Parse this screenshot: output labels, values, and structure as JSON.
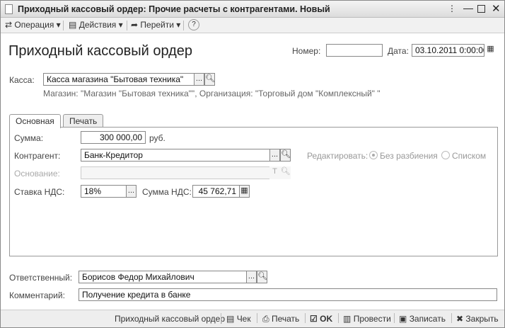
{
  "window": {
    "title": "Приходный кассовый ордер: Прочие расчеты с контрагентами. Новый"
  },
  "toolbar": {
    "operation": "Операция",
    "actions": "Действия",
    "goto": "Перейти",
    "help": "?"
  },
  "header": {
    "title": "Приходный кассовый ордер",
    "number_label": "Номер:",
    "number_value": "",
    "date_label": "Дата:",
    "date_value": "03.10.2011  0:00:00"
  },
  "kassa": {
    "label": "Касса:",
    "value": "Касса магазина \"Бытовая техника\"",
    "info": "Магазин: \"Магазин \"Бытовая техника\"\", Организация: \"Торговый дом \"Комплексный\" \""
  },
  "tabs": [
    {
      "label": "Основная",
      "active": true
    },
    {
      "label": "Печать",
      "active": false
    }
  ],
  "main": {
    "sum_label": "Сумма:",
    "sum_value": "300 000,00",
    "currency": "руб.",
    "contragent_label": "Контрагент:",
    "contragent_value": "Банк-Кредитор",
    "edit_label": "Редактировать:",
    "radio_no_split": "Без разбиения",
    "radio_list": "Списком",
    "radio_selected": "Без разбиения",
    "basis_label": "Основание:",
    "basis_value": "",
    "vat_rate_label": "Ставка НДС:",
    "vat_rate_value": "18%",
    "vat_sum_label": "Сумма НДС:",
    "vat_sum_value": "45 762,71"
  },
  "footer": {
    "responsible_label": "Ответственный:",
    "responsible_value": "Борисов Федор Михайлович",
    "comment_label": "Комментарий:",
    "comment_value": "Получение кредита в банке"
  },
  "bottom": {
    "doc": "Приходный кассовый ордер",
    "check": "Чек",
    "print": "Печать",
    "ok": "OK",
    "post": "Провести",
    "save": "Записать",
    "close": "Закрыть"
  },
  "buttons": {
    "select": "...",
    "clear": "T"
  }
}
